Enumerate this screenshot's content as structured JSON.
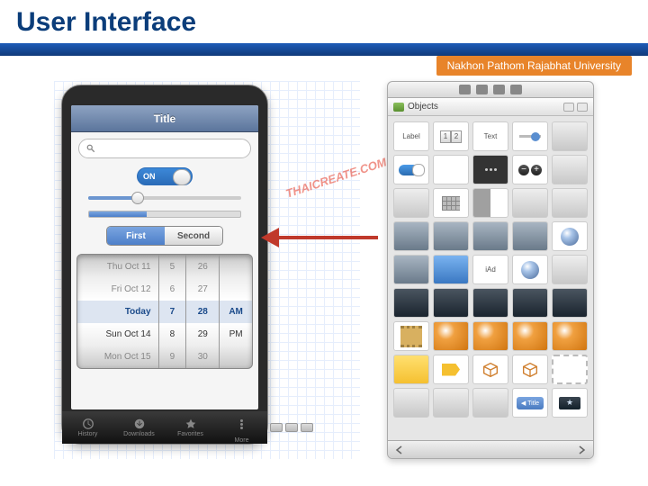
{
  "slide": {
    "title": "User Interface"
  },
  "university": {
    "name": "Nakhon Pathom Rajabhat University"
  },
  "watermark": "THAICREATE.COM",
  "phone": {
    "nav_title": "Title",
    "toggle_label": "ON",
    "segment": {
      "first": "First",
      "second": "Second"
    },
    "tabs": [
      "History",
      "Downloads",
      "Favorites",
      "More"
    ],
    "search_placeholder": ""
  },
  "picker": {
    "col1": [
      "Thu Oct 11",
      "Fri Oct 12",
      "Today",
      "Sun Oct 14",
      "Mon Oct 15"
    ],
    "col2": [
      "5",
      "6",
      "7",
      "8",
      "9"
    ],
    "col3": [
      "26",
      "27",
      "28",
      "29",
      "30"
    ],
    "col4": [
      "",
      "",
      "AM",
      "PM",
      ""
    ]
  },
  "library": {
    "header": "Objects",
    "cells": {
      "label": "Label",
      "text": "Text",
      "seg1": "1",
      "seg2": "2",
      "iad": "iAd"
    }
  }
}
